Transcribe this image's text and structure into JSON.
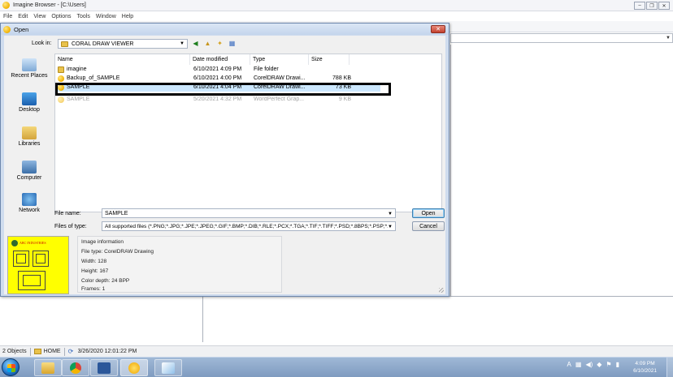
{
  "app": {
    "title": "Imagine Browser - [C:\\Users]",
    "menu": [
      "File",
      "Edit",
      "View",
      "Options",
      "Tools",
      "Window",
      "Help"
    ],
    "window_controls": [
      "–",
      "❐",
      "✕"
    ]
  },
  "dialog": {
    "title": "Open",
    "close_label": "✕",
    "look_in_label": "Look in:",
    "look_in_value": "CORAL DRAW VIEWER",
    "places": [
      "Recent Places",
      "Desktop",
      "Libraries",
      "Computer",
      "Network"
    ],
    "columns": [
      "Name",
      "Date modified",
      "Type",
      "Size"
    ],
    "files": [
      {
        "name": "imagine",
        "date": "6/10/2021 4:09 PM",
        "type": "File folder",
        "size": "",
        "icon": "folder-icon"
      },
      {
        "name": "Backup_of_SAMPLE",
        "date": "6/10/2021 4:00 PM",
        "type": "CorelDRAW Drawi...",
        "size": "788 KB",
        "icon": "coreldraw-file-icon"
      },
      {
        "name": "SAMPLE",
        "date": "6/10/2021 4:04 PM",
        "type": "CorelDRAW Drawi...",
        "size": "73 KB",
        "icon": "coreldraw-file-icon"
      },
      {
        "name": "SAMPLE",
        "date": "5/20/2021 4:32 PM",
        "type": "WordPerfect Grap...",
        "size": "9 KB",
        "icon": "wordperfect-file-icon"
      }
    ],
    "selected_index": 2,
    "file_name_label": "File name:",
    "file_name_value": "SAMPLE",
    "file_type_label": "Files of type:",
    "file_type_value": "All supported files (*.PNG;*.JPG;*.JPE;*.JPEG;*.GIF;*.BMP;*.DIB;*.RLE;*.PCX;*.TGA;*.TIF;*.TIFF;*.PSD;*.8BPS;*.PSP;*.I",
    "open_label": "Open",
    "cancel_label": "Cancel",
    "preview_logo_text": "ABC INDUSTRIES",
    "image_info": {
      "heading": "Image information",
      "file_type": "File type: CorelDRAW Drawing",
      "width": "Width: 128",
      "height": "Height: 167",
      "color_depth": "Color depth: 24 BPP",
      "frames": "Frames: 1"
    }
  },
  "status": {
    "objects": "2 Objects",
    "location": "HOME",
    "timestamp": "3/26/2020 12:01:22 PM"
  },
  "taskbar": {
    "apps": [
      "explorer-icon",
      "chrome-icon",
      "word-icon",
      "imagine-icon",
      "paint-icon"
    ],
    "clock_time": "4:09 PM",
    "clock_date": "6/10/2021",
    "colors": {
      "taskbar": "#8fa9cb",
      "selection": "#cce8ff",
      "preview_bg": "#ffff00"
    }
  }
}
